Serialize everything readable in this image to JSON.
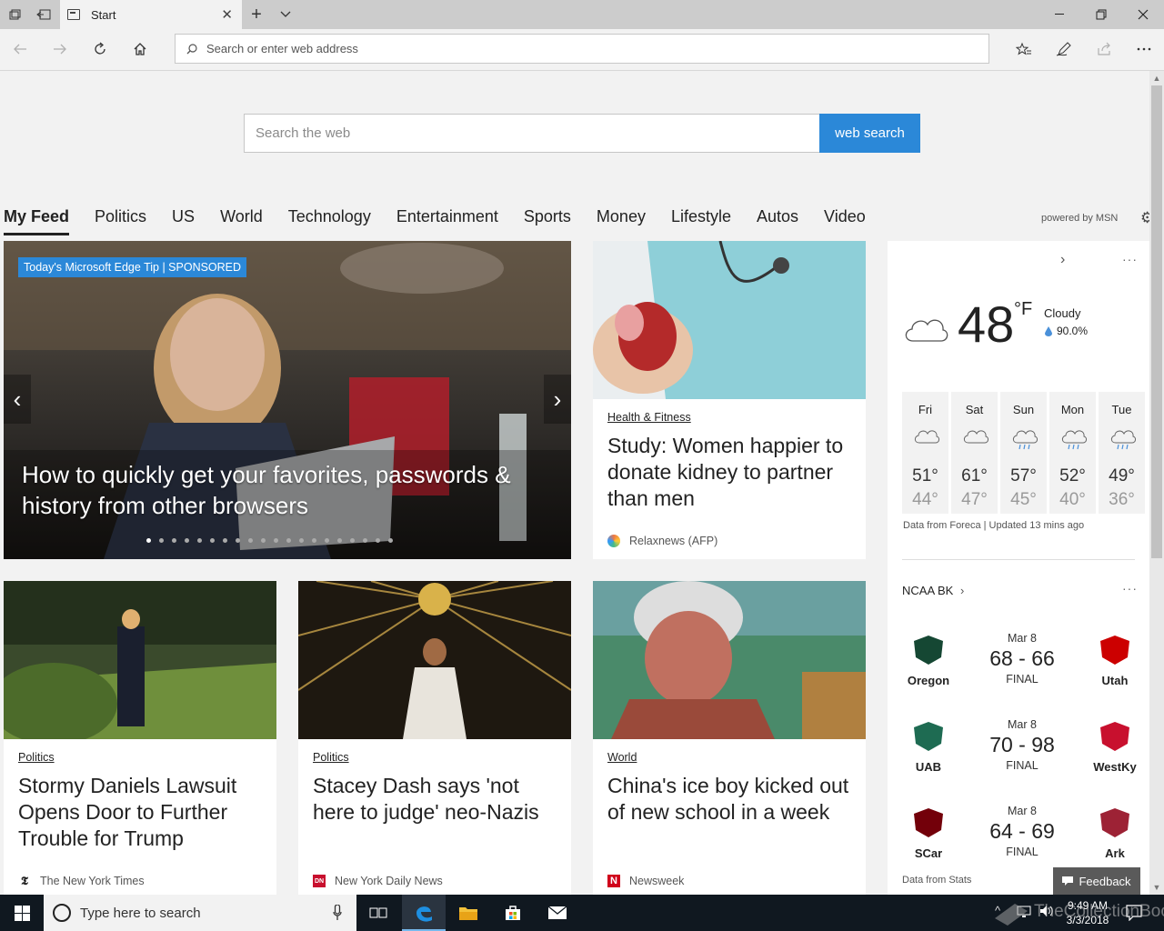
{
  "browser": {
    "tab_title": "Start",
    "address_placeholder": "Search or enter web address"
  },
  "search": {
    "placeholder": "Search the web",
    "button_label": "web search"
  },
  "categories": [
    "My Feed",
    "Politics",
    "US",
    "World",
    "Technology",
    "Entertainment",
    "Sports",
    "Money",
    "Lifestyle",
    "Autos",
    "Video"
  ],
  "powered_by": "powered by MSN",
  "hero": {
    "badge": "Today's Microsoft Edge Tip | SPONSORED",
    "title": "How to quickly get your favorites, passwords & history from other browsers",
    "slide_count": 20,
    "active_slide": 1
  },
  "articles": [
    {
      "category": "Health & Fitness",
      "headline": "Study: Women happier to donate kidney to partner than men",
      "source": "Relaxnews (AFP)"
    },
    {
      "category": "Politics",
      "headline": "Stormy Daniels Lawsuit Opens Door to Further Trouble for Trump",
      "source": "The New York Times"
    },
    {
      "category": "Politics",
      "headline": "Stacey Dash says 'not here to judge' neo-Nazis",
      "source": "New York Daily News"
    },
    {
      "category": "World",
      "headline": "China's ice boy kicked out of new school in a week",
      "source": "Newsweek"
    }
  ],
  "weather": {
    "temp": "48",
    "unit": "°F",
    "condition": "Cloudy",
    "precip": "90.0%",
    "forecast": [
      {
        "day": "Fri",
        "hi": "51°",
        "lo": "44°",
        "icon": "cloud-icon"
      },
      {
        "day": "Sat",
        "hi": "61°",
        "lo": "47°",
        "icon": "cloud-icon"
      },
      {
        "day": "Sun",
        "hi": "57°",
        "lo": "45°",
        "icon": "rain-icon"
      },
      {
        "day": "Mon",
        "hi": "52°",
        "lo": "40°",
        "icon": "rain-icon"
      },
      {
        "day": "Tue",
        "hi": "49°",
        "lo": "36°",
        "icon": "rain-icon"
      }
    ],
    "source": "Data from Foreca | Updated 13 mins ago"
  },
  "scores": {
    "title": "NCAA BK",
    "source": "Data from Stats",
    "games": [
      {
        "date": "Mar 8",
        "score": "68 - 66",
        "status": "FINAL",
        "home": "Oregon",
        "away": "Utah",
        "home_color": "#154733",
        "away_color": "#cc0000"
      },
      {
        "date": "Mar 8",
        "score": "70 - 98",
        "status": "FINAL",
        "home": "UAB",
        "away": "WestKy",
        "home_color": "#1e6b52",
        "away_color": "#c8102e"
      },
      {
        "date": "Mar 8",
        "score": "64 - 69",
        "status": "FINAL",
        "home": "SCar",
        "away": "Ark",
        "home_color": "#73000a",
        "away_color": "#9d2235"
      }
    ]
  },
  "feedback_label": "Feedback",
  "taskbar": {
    "search_placeholder": "Type here to search",
    "time": "9:49 AM",
    "date": "3/3/2018"
  },
  "watermark": "TheCollectionBook",
  "colors": {
    "accent": "#2b88d8"
  }
}
